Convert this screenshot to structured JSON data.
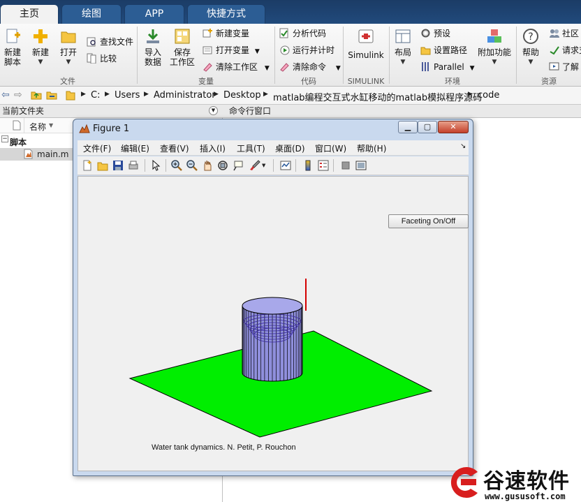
{
  "tabs": [
    {
      "label": "主页",
      "active": true
    },
    {
      "label": "绘图",
      "active": false
    },
    {
      "label": "APP",
      "active": false
    },
    {
      "label": "快捷方式",
      "active": false
    }
  ],
  "ribbon": {
    "file": {
      "new_script": "新建\n脚本",
      "new": "新建",
      "open": "打开",
      "find_files": "查找文件",
      "compare": "比较",
      "group": "文件"
    },
    "variable": {
      "import_data": "导入\n数据",
      "save_workspace": "保存\n工作区",
      "new_variable": "新建变量",
      "open_variable": "打开变量",
      "clear_workspace": "清除工作区",
      "group": "变量"
    },
    "code": {
      "analyze_code": "分析代码",
      "run_and_time": "运行并计时",
      "clear_commands": "清除命令",
      "group": "代码"
    },
    "simulink": {
      "label": "Simulink",
      "group": "SIMULINK"
    },
    "environment": {
      "layout": "布局",
      "preferences": "预设",
      "set_path": "设置路径",
      "parallel": "Parallel",
      "addons": "附加功能",
      "group": "环境"
    },
    "resources": {
      "help": "帮助",
      "community": "社区",
      "request_support": "请求支",
      "learn": "了解",
      "group": "资源"
    }
  },
  "address": {
    "crumbs": [
      "C:",
      "Users",
      "Administrator",
      "Desktop",
      "matlab编程交互式水缸移动的matlab模拟程序源码",
      "code"
    ]
  },
  "current_folder": {
    "title": "当前文件夹",
    "column_name": "名称",
    "group": "脚本",
    "file": "main.m"
  },
  "command_window": {
    "title": "命令行窗口"
  },
  "figure": {
    "title": "Figure 1",
    "menu": [
      "文件(F)",
      "编辑(E)",
      "查看(V)",
      "插入(I)",
      "工具(T)",
      "桌面(D)",
      "窗口(W)",
      "帮助(H)"
    ],
    "facet_button": "Faceting On/Off",
    "caption": "Water tank dynamics. N. Petit, P. Rouchon",
    "colors": {
      "ground": "#00ee00",
      "tank": "#8f8fdc",
      "marker": "#d40000"
    }
  },
  "watermark": {
    "brand": "谷速软件",
    "url": "www.gususoft.com"
  }
}
